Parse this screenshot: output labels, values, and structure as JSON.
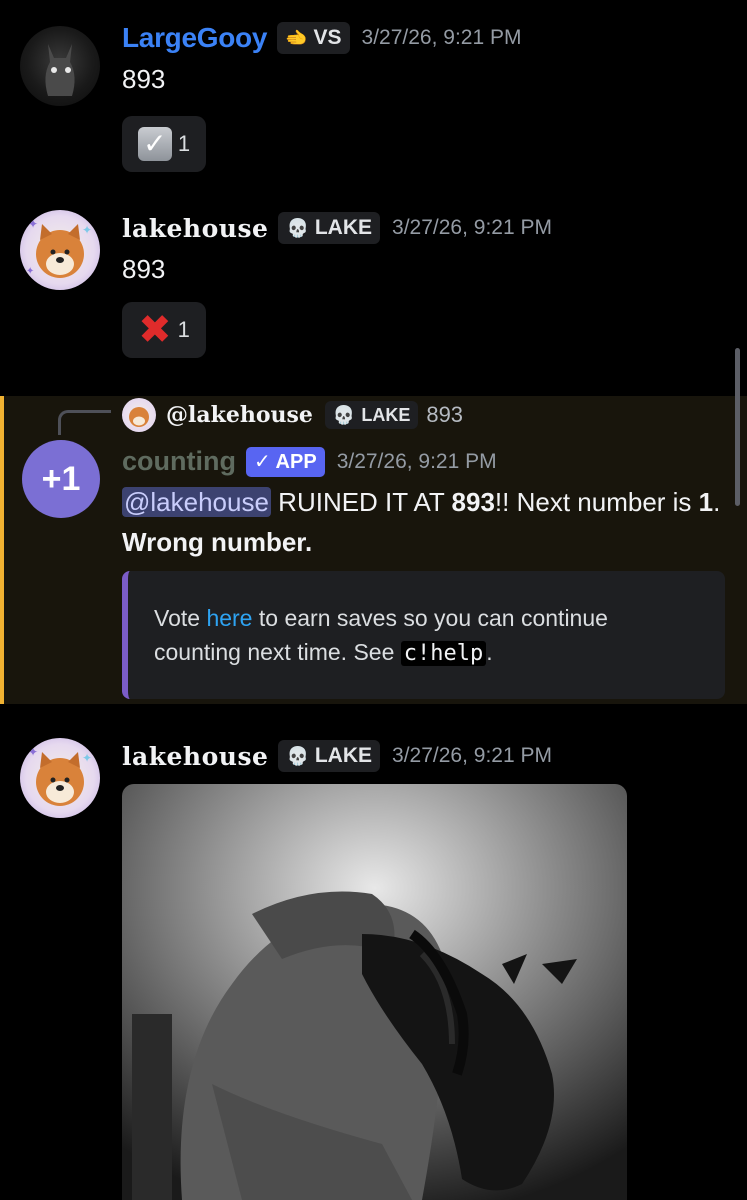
{
  "messages": [
    {
      "username": "LargeGooy",
      "tag_icon": "wave-icon",
      "tag": "VS",
      "timestamp": "3/27/26, 9:21 PM",
      "content": "893",
      "reaction": {
        "icon": "checkmark-box-icon",
        "count": "1"
      }
    },
    {
      "username": "lakehouse",
      "tag_icon": "skull-icon",
      "tag": "LAKE",
      "timestamp": "3/27/26, 9:21 PM",
      "content": "893",
      "reaction": {
        "icon": "cross-mark-icon",
        "count": "1"
      }
    },
    {
      "reply": {
        "username": "@lakehouse",
        "tag": "LAKE",
        "text": "893"
      },
      "avatar_text": "+1",
      "username": "counting",
      "app_badge": "✓ APP",
      "timestamp": "3/27/26, 9:21 PM",
      "content": {
        "mention": "@lakehouse",
        "part1": " RUINED IT AT ",
        "number": "893",
        "part2": "!! Next number is ",
        "next": "1",
        "part3": ". ",
        "reason": "Wrong number."
      },
      "embed": {
        "text1": "Vote ",
        "link": "here",
        "text2": " to earn saves so you can continue counting next time. See ",
        "command": "c!help",
        "text3": "."
      }
    },
    {
      "username": "lakehouse",
      "tag": "LAKE",
      "timestamp": "3/27/26, 9:21 PM",
      "attachment": "image"
    }
  ],
  "colors": {
    "background": "#000000",
    "link_blue": "#3b82f6",
    "highlight_border": "#f0b232",
    "app_badge": "#5865f2",
    "embed_border": "#7b5cc8",
    "bot_avatar": "#7b6fd4"
  }
}
